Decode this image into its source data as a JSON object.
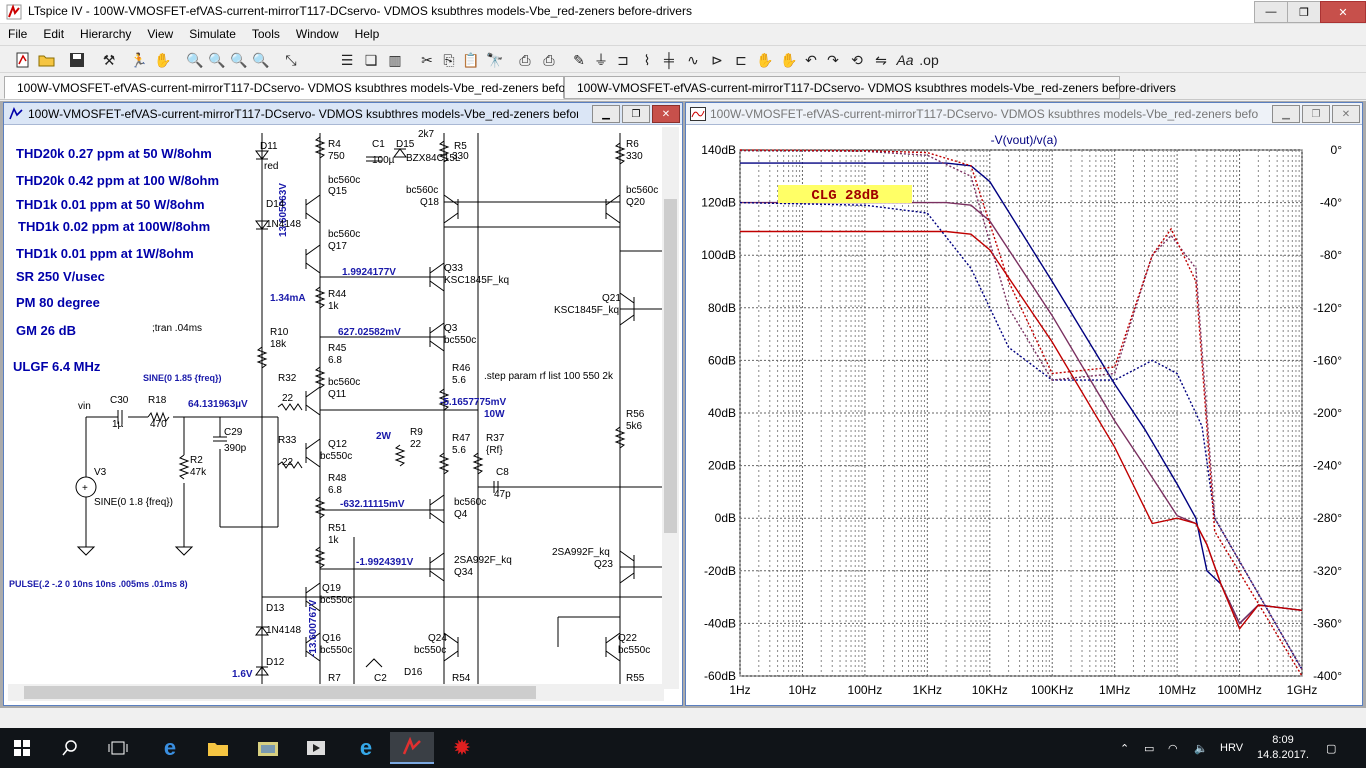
{
  "window": {
    "title": "LTspice IV - 100W-VMOSFET-efVAS-current-mirrorT117-DCservo- VDMOS ksubthres models-Vbe_red-zeners before-drivers",
    "minimize": "—",
    "maximize": "❐",
    "close": "✕"
  },
  "menu": [
    "File",
    "Edit",
    "Hierarchy",
    "View",
    "Simulate",
    "Tools",
    "Window",
    "Help"
  ],
  "tabs": [
    {
      "label": "100W-VMOSFET-efVAS-current-mirrorT117-DCservo- VDMOS ksubthres models-Vbe_red-zeners before-drivers",
      "icon": "schematic-icon"
    },
    {
      "label": "100W-VMOSFET-efVAS-current-mirrorT117-DCservo- VDMOS ksubthres models-Vbe_red-zeners before-drivers",
      "icon": "waveform-icon"
    }
  ],
  "schematic": {
    "title": "100W-VMOSFET-efVAS-current-mirrorT117-DCservo- VDMOS ksubthres models-Vbe_red-zeners befor...",
    "notes": [
      "THD20k 0.27 ppm at 50 W/8ohm",
      "THD20k 0.42 ppm at 100 W/8ohm",
      "THD1k 0.01 ppm at 50 W/8ohm",
      "THD1k 0.02 ppm at 100W/8ohm",
      "THD1k 0.01 ppm at 1W/8ohm",
      "SR 250 V/usec",
      "PM  80 degree",
      "GM  26 dB",
      "ULGF 6.4 MHz"
    ],
    "directives": {
      "tran": ";tran .04ms",
      "step": ".step param rf list 100 550 2k",
      "pulse": "PULSE(.2 -.2 0 10ns 10ns .005ms .01ms 8)",
      "sine1": "SINE(0 1.85 {freq})",
      "sine2": "SINE(0 1.8 {freq})"
    },
    "voltages": {
      "v1": "1.9924177V",
      "v2": "627.02582mV",
      "v3": "64.131963µV",
      "v4": "-5.1657775mV",
      "v5": "-632.11115mV",
      "v6": "-1.9924391V",
      "v7": "13.605063V",
      "v8": "-13.600767V",
      "i1": "1.34mA",
      "p1": "2W",
      "p2": "10W",
      "v9": "1.6V"
    },
    "components": {
      "d11": "D11",
      "d11v": "red",
      "r4": "R4",
      "r4v": "750",
      "c1": "C1",
      "c1v": "100µ",
      "d15": "D15",
      "d15v": "BZX84C15L",
      "r5": "R5",
      "r5v": "330",
      "r5x": "2k7",
      "r6": "R6",
      "r6v": "330",
      "q15": "Q15",
      "q15m": "bc560c",
      "q18": "Q18",
      "q18m": "bc560c",
      "q20": "Q20",
      "q20m": "bc560c",
      "d14": "D14",
      "d14v": "1N4148",
      "q17": "Q17",
      "q17m": "bc560c",
      "q33": "Q33",
      "q33m": "KSC1845F_kq",
      "q21": "Q21",
      "q21m": "KSC1845F_kq",
      "r44": "R44",
      "r44v": "1k",
      "r10": "R10",
      "r10v": "18k",
      "q3": "Q3",
      "q3m": "bc550c",
      "r45": "R45",
      "r45v": "6.8",
      "r46": "R46",
      "r46v": "5.6",
      "q11": "Q11",
      "q11m": "bc560c",
      "r32": "R32",
      "r32v": "22",
      "r56": "R56",
      "r56v": "5k6",
      "vin": "vin",
      "c30": "C30",
      "c30v": "1µ",
      "r18": "R18",
      "r18v": "470",
      "c29": "C29",
      "c29v": "390p",
      "r9": "R9",
      "r9v": "22",
      "r47": "R47",
      "r47v": "5.6",
      "r37": "R37",
      "r37v": "{Rf}",
      "r33": "R33",
      "r33v": "22",
      "q12": "Q12",
      "q12m": "bc550c",
      "r2": "R2",
      "r2v": "47k",
      "v3": "V3",
      "c8": "C8",
      "c8v": "47p",
      "r48": "R48",
      "r48v": "6.8",
      "q4": "Q4",
      "q4m": "bc560c",
      "r51": "R51",
      "r51v": "1k",
      "q34": "Q34",
      "q34m": "2SA992F_kq",
      "q23": "Q23",
      "q23m": "2SA992F_kq",
      "q19": "Q19",
      "q19m": "bc550c",
      "d13": "D13",
      "d13v": "1N4148",
      "q16": "Q16",
      "q16m": "bc550c",
      "q24": "Q24",
      "q24m": "bc550c",
      "q22": "Q22",
      "q22m": "bc550c",
      "d12": "D12",
      "r7": "R7",
      "c2": "C2",
      "d16": "D16",
      "r54": "R54",
      "r55": "R55"
    }
  },
  "plot": {
    "title": "100W-VMOSFET-efVAS-current-mirrorT117-DCservo- VDMOS ksubthres models-Vbe_red-zeners befor...",
    "annotation": "CLG  28dB",
    "colors": {
      "blue": "#000080",
      "purple": "#7a3060",
      "red": "#c00000"
    }
  },
  "chart_data": {
    "type": "line",
    "title": "-V(vout)/v(a)",
    "xscale": "log",
    "xlim": [
      1,
      1000000000
    ],
    "x_ticks": [
      "1Hz",
      "10Hz",
      "100Hz",
      "1KHz",
      "10KHz",
      "100KHz",
      "1MHz",
      "10MHz",
      "100MHz",
      "1GHz"
    ],
    "ylim_left": [
      -60,
      140
    ],
    "y_left_ticks": [
      "140dB",
      "120dB",
      "100dB",
      "80dB",
      "60dB",
      "40dB",
      "20dB",
      "0dB",
      "-20dB",
      "-40dB",
      "-60dB"
    ],
    "ylim_right": [
      -400,
      0
    ],
    "y_right_ticks": [
      "0°",
      "-40°",
      "-80°",
      "-120°",
      "-160°",
      "-200°",
      "-240°",
      "-280°",
      "-320°",
      "-360°",
      "-400°"
    ],
    "grid": true,
    "series": [
      {
        "color": "#000080",
        "kind": "magnitude",
        "x": [
          1,
          2000,
          5000,
          10000,
          100000,
          1000000,
          3000000,
          10000000,
          20000000,
          30000000,
          50000000,
          100000000,
          200000000,
          1000000000
        ],
        "values": [
          135,
          135,
          134,
          128,
          90,
          51,
          34,
          13,
          0,
          -20,
          -25,
          -40,
          -33,
          -35
        ]
      },
      {
        "color": "#7a3060",
        "kind": "magnitude",
        "x": [
          1,
          2000,
          5000,
          10000,
          100000,
          1000000,
          3000000,
          10000000,
          20000000,
          30000000,
          50000000,
          100000000,
          200000000,
          1000000000
        ],
        "values": [
          120,
          120,
          119,
          113,
          77,
          37,
          20,
          1,
          -2,
          -10,
          -25,
          -40,
          -33,
          -35
        ]
      },
      {
        "color": "#c00000",
        "kind": "magnitude",
        "x": [
          1,
          2000,
          5000,
          10000,
          100000,
          1000000,
          4000000,
          10000000,
          20000000,
          30000000,
          50000000,
          100000000,
          200000000,
          1000000000
        ],
        "values": [
          109,
          109,
          108,
          102,
          67,
          27,
          -2,
          0,
          -2,
          -10,
          -25,
          -42,
          -33,
          -35
        ]
      },
      {
        "color": "#000080",
        "kind": "phase",
        "x": [
          1,
          100,
          1000,
          5000,
          20000,
          100000,
          1000000,
          4000000,
          10000000,
          25000000,
          40000000,
          1000000000
        ],
        "values": [
          -40,
          -42,
          -48,
          -90,
          -150,
          -175,
          -175,
          -160,
          -170,
          -210,
          -280,
          -395
        ]
      },
      {
        "color": "#7a3060",
        "kind": "phase",
        "x": [
          1,
          100,
          1000,
          5000,
          20000,
          100000,
          1000000,
          4000000,
          8000000,
          20000000,
          40000000,
          1000000000
        ],
        "values": [
          -0.5,
          -1,
          -4,
          -20,
          -120,
          -175,
          -170,
          -80,
          -65,
          -90,
          -280,
          -395
        ]
      },
      {
        "color": "#c00000",
        "kind": "phase",
        "x": [
          1,
          100,
          1000,
          5000,
          20000,
          100000,
          1000000,
          4000000,
          8000000,
          20000000,
          40000000,
          1000000000
        ],
        "values": [
          0,
          -0.5,
          -2,
          -12,
          -100,
          -170,
          -165,
          -80,
          -60,
          -100,
          -290,
          -400
        ]
      }
    ]
  },
  "taskbar": {
    "lang": "HRV",
    "time": "8:09",
    "date": "14.8.2017."
  }
}
